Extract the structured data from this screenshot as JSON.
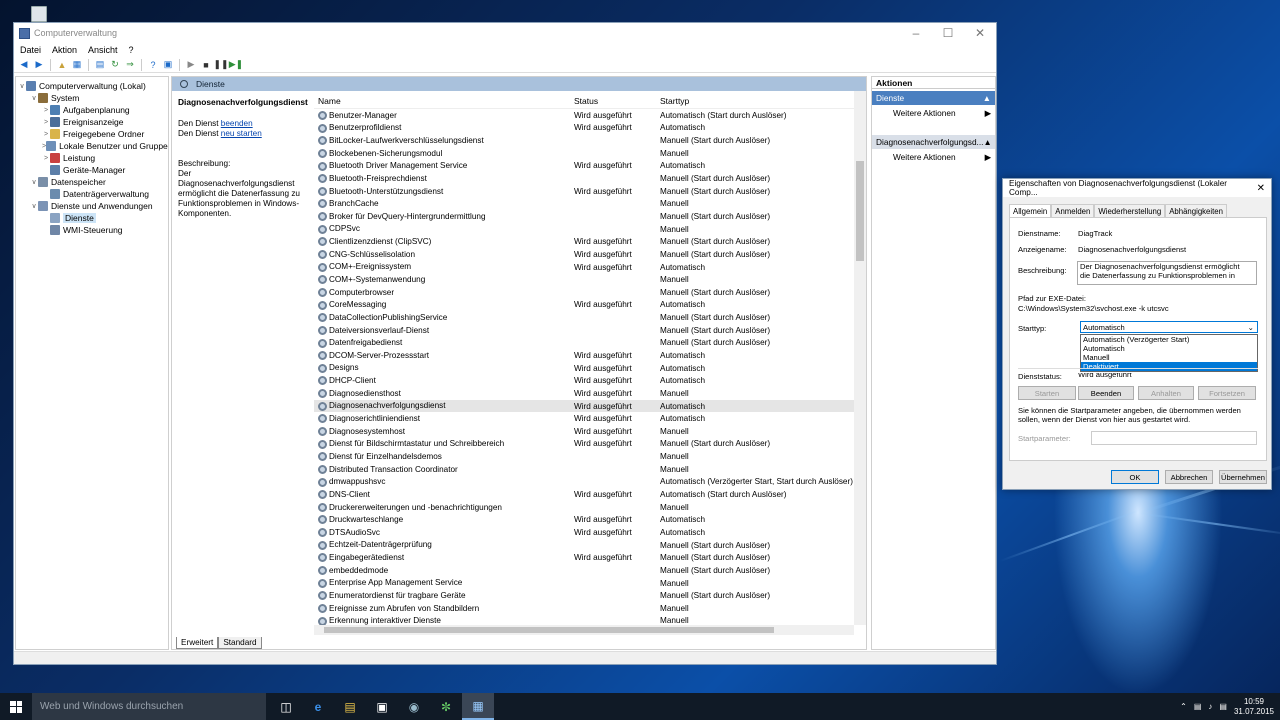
{
  "window": {
    "title": "Computerverwaltung",
    "menu": [
      "Datei",
      "Aktion",
      "Ansicht",
      "?"
    ]
  },
  "tree": [
    {
      "label": "Computerverwaltung (Lokal)",
      "indent": 0,
      "tw": "∨",
      "icon": "#5a7fb0",
      "name": "tree-root"
    },
    {
      "label": "System",
      "indent": 1,
      "tw": "∨",
      "icon": "#8a6d3b",
      "name": "tree-system"
    },
    {
      "label": "Aufgabenplanung",
      "indent": 2,
      "tw": ">",
      "icon": "#4d7fb3",
      "name": "tree-aufgabenplanung"
    },
    {
      "label": "Ereignisanzeige",
      "indent": 2,
      "tw": ">",
      "icon": "#4b6e9a",
      "name": "tree-ereignisanzeige"
    },
    {
      "label": "Freigegebene Ordner",
      "indent": 2,
      "tw": ">",
      "icon": "#d9b44a",
      "name": "tree-freigegebene-ordner"
    },
    {
      "label": "Lokale Benutzer und Gruppen",
      "indent": 2,
      "tw": ">",
      "icon": "#6d8fb8",
      "name": "tree-benutzer-gruppen"
    },
    {
      "label": "Leistung",
      "indent": 2,
      "tw": ">",
      "icon": "#c84040",
      "name": "tree-leistung"
    },
    {
      "label": "Geräte-Manager",
      "indent": 2,
      "tw": "",
      "icon": "#5b7ea8",
      "name": "tree-geraete-manager"
    },
    {
      "label": "Datenspeicher",
      "indent": 1,
      "tw": "∨",
      "icon": "#7a8fa8",
      "name": "tree-datenspeicher"
    },
    {
      "label": "Datenträgerverwaltung",
      "indent": 2,
      "tw": "",
      "icon": "#6b8cae",
      "name": "tree-datentraegerverwaltung"
    },
    {
      "label": "Dienste und Anwendungen",
      "indent": 1,
      "tw": "∨",
      "icon": "#7b93b5",
      "name": "tree-dienste-anwendungen"
    },
    {
      "label": "Dienste",
      "indent": 2,
      "tw": "",
      "icon": "#8aa3c2",
      "name": "tree-dienste",
      "selected": true
    },
    {
      "label": "WMI-Steuerung",
      "indent": 2,
      "tw": "",
      "icon": "#6f86a6",
      "name": "tree-wmi"
    }
  ],
  "center": {
    "header": "Dienste",
    "desc_title": "Diagnosenachverfolgungsdienst",
    "line1_prefix": "Den Dienst ",
    "line1_link": "beenden",
    "line2_prefix": "Den Dienst ",
    "line2_link": "neu starten",
    "desc_label": "Beschreibung:",
    "desc_text": "Der Diagnosenachverfolgungsdienst ermöglicht die Datenerfassung zu Funktionsproblemen in Windows-Komponenten.",
    "columns": [
      "Name",
      "Status",
      "Starttyp"
    ],
    "tabs": [
      "Erweitert",
      "Standard"
    ]
  },
  "services": [
    [
      "Benutzer-Manager",
      "Wird ausgeführt",
      "Automatisch (Start durch Auslöser)"
    ],
    [
      "Benutzerprofildienst",
      "Wird ausgeführt",
      "Automatisch"
    ],
    [
      "BitLocker-Laufwerkverschlüsselungsdienst",
      "",
      "Manuell (Start durch Auslöser)"
    ],
    [
      "Blockebenen-Sicherungsmodul",
      "",
      "Manuell"
    ],
    [
      "Bluetooth Driver Management Service",
      "Wird ausgeführt",
      "Automatisch"
    ],
    [
      "Bluetooth-Freisprechdienst",
      "",
      "Manuell (Start durch Auslöser)"
    ],
    [
      "Bluetooth-Unterstützungsdienst",
      "Wird ausgeführt",
      "Manuell (Start durch Auslöser)"
    ],
    [
      "BranchCache",
      "",
      "Manuell"
    ],
    [
      "Broker für DevQuery-Hintergrundermittlung",
      "",
      "Manuell (Start durch Auslöser)"
    ],
    [
      "CDPSvc",
      "",
      "Manuell"
    ],
    [
      "Clientlizenzdienst (ClipSVC)",
      "Wird ausgeführt",
      "Manuell (Start durch Auslöser)"
    ],
    [
      "CNG-Schlüsselisolation",
      "Wird ausgeführt",
      "Manuell (Start durch Auslöser)"
    ],
    [
      "COM+-Ereignissystem",
      "Wird ausgeführt",
      "Automatisch"
    ],
    [
      "COM+-Systemanwendung",
      "",
      "Manuell"
    ],
    [
      "Computerbrowser",
      "",
      "Manuell (Start durch Auslöser)"
    ],
    [
      "CoreMessaging",
      "Wird ausgeführt",
      "Automatisch"
    ],
    [
      "DataCollectionPublishingService",
      "",
      "Manuell (Start durch Auslöser)"
    ],
    [
      "Dateiversionsverlauf-Dienst",
      "",
      "Manuell (Start durch Auslöser)"
    ],
    [
      "Datenfreigabedienst",
      "",
      "Manuell (Start durch Auslöser)"
    ],
    [
      "DCOM-Server-Prozessstart",
      "Wird ausgeführt",
      "Automatisch"
    ],
    [
      "Designs",
      "Wird ausgeführt",
      "Automatisch"
    ],
    [
      "DHCP-Client",
      "Wird ausgeführt",
      "Automatisch"
    ],
    [
      "Diagnosediensthost",
      "Wird ausgeführt",
      "Manuell"
    ],
    [
      "Diagnosenachverfolgungsdienst",
      "Wird ausgeführt",
      "Automatisch"
    ],
    [
      "Diagnoserichtliniendienst",
      "Wird ausgeführt",
      "Automatisch"
    ],
    [
      "Diagnosesystemhost",
      "Wird ausgeführt",
      "Manuell"
    ],
    [
      "Dienst für Bildschirmtastatur und Schreibbereich",
      "Wird ausgeführt",
      "Manuell (Start durch Auslöser)"
    ],
    [
      "Dienst für Einzelhandelsdemos",
      "",
      "Manuell"
    ],
    [
      "Distributed Transaction Coordinator",
      "",
      "Manuell"
    ],
    [
      "dmwappushsvc",
      "",
      "Automatisch (Verzögerter Start, Start durch Auslöser)"
    ],
    [
      "DNS-Client",
      "Wird ausgeführt",
      "Automatisch (Start durch Auslöser)"
    ],
    [
      "Druckererweiterungen und -benachrichtigungen",
      "",
      "Manuell"
    ],
    [
      "Druckwarteschlange",
      "Wird ausgeführt",
      "Automatisch"
    ],
    [
      "DTSAudioSvc",
      "Wird ausgeführt",
      "Automatisch"
    ],
    [
      "Echtzeit-Datenträgerprüfung",
      "",
      "Manuell (Start durch Auslöser)"
    ],
    [
      "Eingabegerätedienst",
      "Wird ausgeführt",
      "Manuell (Start durch Auslöser)"
    ],
    [
      "embeddedmode",
      "",
      "Manuell (Start durch Auslöser)"
    ],
    [
      "Enterprise App Management Service",
      "",
      "Manuell"
    ],
    [
      "Enumeratordienst für tragbare Geräte",
      "",
      "Manuell (Start durch Auslöser)"
    ],
    [
      "Ereignisse zum Abrufen von Standbildern",
      "",
      "Manuell"
    ],
    [
      "Erkennung interaktiver Dienste",
      "",
      "Manuell"
    ]
  ],
  "selected_service": "Diagnosenachverfolgungsdienst",
  "actions": {
    "title": "Aktionen",
    "s1": "Dienste",
    "s1_item": "Weitere Aktionen",
    "s2": "Diagnosenachverfolgungsd...",
    "s2_item": "Weitere Aktionen"
  },
  "dialog": {
    "title": "Eigenschaften von Diagnosenachverfolgungsdienst (Lokaler Comp...",
    "tabs": [
      "Allgemein",
      "Anmelden",
      "Wiederherstellung",
      "Abhängigkeiten"
    ],
    "dienstname_label": "Dienstname:",
    "dienstname": "DiagTrack",
    "anzeigename_label": "Anzeigename:",
    "anzeigename": "Diagnosenachverfolgungsdienst",
    "beschreibung_label": "Beschreibung:",
    "beschreibung": "Der Diagnosenachverfolgungsdienst ermöglicht die Datenerfassung zu Funktionsproblemen in",
    "pfad_label": "Pfad zur EXE-Datei:",
    "pfad": "C:\\Windows\\System32\\svchost.exe -k utcsvc",
    "starttyp_label": "Starttyp:",
    "starttyp": "Automatisch",
    "options": [
      "Automatisch (Verzögerter Start)",
      "Automatisch",
      "Manuell",
      "Deaktiviert"
    ],
    "status_label": "Dienststatus:",
    "status": "Wird ausgeführt",
    "btn_starten": "Starten",
    "btn_beenden": "Beenden",
    "btn_anhalten": "Anhalten",
    "btn_fortsetzen": "Fortsetzen",
    "hint": "Sie können die Startparameter angeben, die übernommen werden sollen, wenn der Dienst von hier aus gestartet wird.",
    "param_label": "Startparameter:",
    "ok": "OK",
    "cancel": "Abbrechen",
    "apply": "Übernehmen"
  },
  "taskbar": {
    "search": "Web und Windows durchsuchen",
    "time": "10:59",
    "date": "31.07.2015"
  }
}
